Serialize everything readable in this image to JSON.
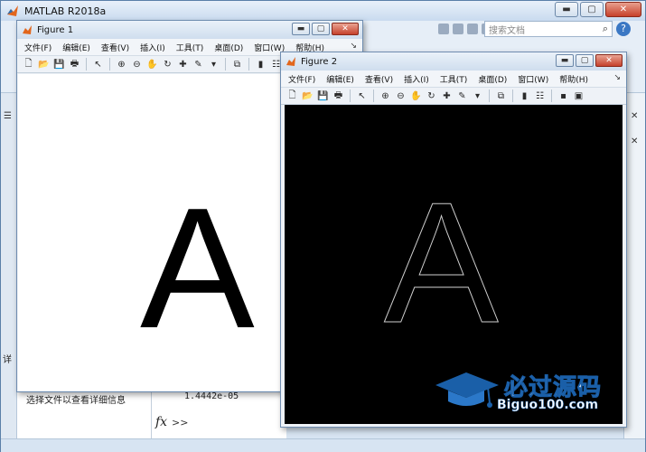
{
  "main_window": {
    "title": "MATLAB R2018a",
    "search_placeholder": "搜索文档",
    "minimize_icon": "minimize-icon",
    "maximize_icon": "maximize-icon",
    "close_icon": "close-icon"
  },
  "side_panel": {
    "detail_tab": "详",
    "detail_hint": "选择文件以查看详细信息"
  },
  "command_window": {
    "value": "1.4442e-05",
    "fx_label": "fx",
    "prompt": ">>"
  },
  "figure1": {
    "title": "Figure 1",
    "menus": [
      "文件(F)",
      "编辑(E)",
      "查看(V)",
      "插入(I)",
      "工具(T)",
      "桌面(D)",
      "窗口(W)",
      "帮助(H)"
    ],
    "image_letter": "A",
    "image_style": "filled black letter on white"
  },
  "figure2": {
    "title": "Figure 2",
    "menus": [
      "文件(F)",
      "编辑(E)",
      "查看(V)",
      "插入(I)",
      "工具(T)",
      "桌面(D)",
      "窗口(W)",
      "帮助(H)"
    ],
    "image_letter": "A",
    "image_style": "white edge outline on black"
  },
  "toolbar_icons": [
    "new-file-icon",
    "open-folder-icon",
    "save-icon",
    "print-icon",
    "pointer-icon",
    "zoom-in-icon",
    "zoom-out-icon",
    "pan-hand-icon",
    "rotate-3d-icon",
    "data-cursor-icon",
    "brush-icon",
    "link-icon",
    "colorbar-icon",
    "legend-icon",
    "hide-plot-tools-icon",
    "show-plot-tools-icon"
  ],
  "watermark": {
    "cn_text": "必过源码",
    "en_text": "Biguo100.com"
  },
  "colors": {
    "titlebar": "#cfdeee",
    "close_red": "#c5412c",
    "desktop_blue": "#2e6c9e",
    "figure2_bg": "#000000",
    "watermark_blue": "#1a5fa8"
  }
}
